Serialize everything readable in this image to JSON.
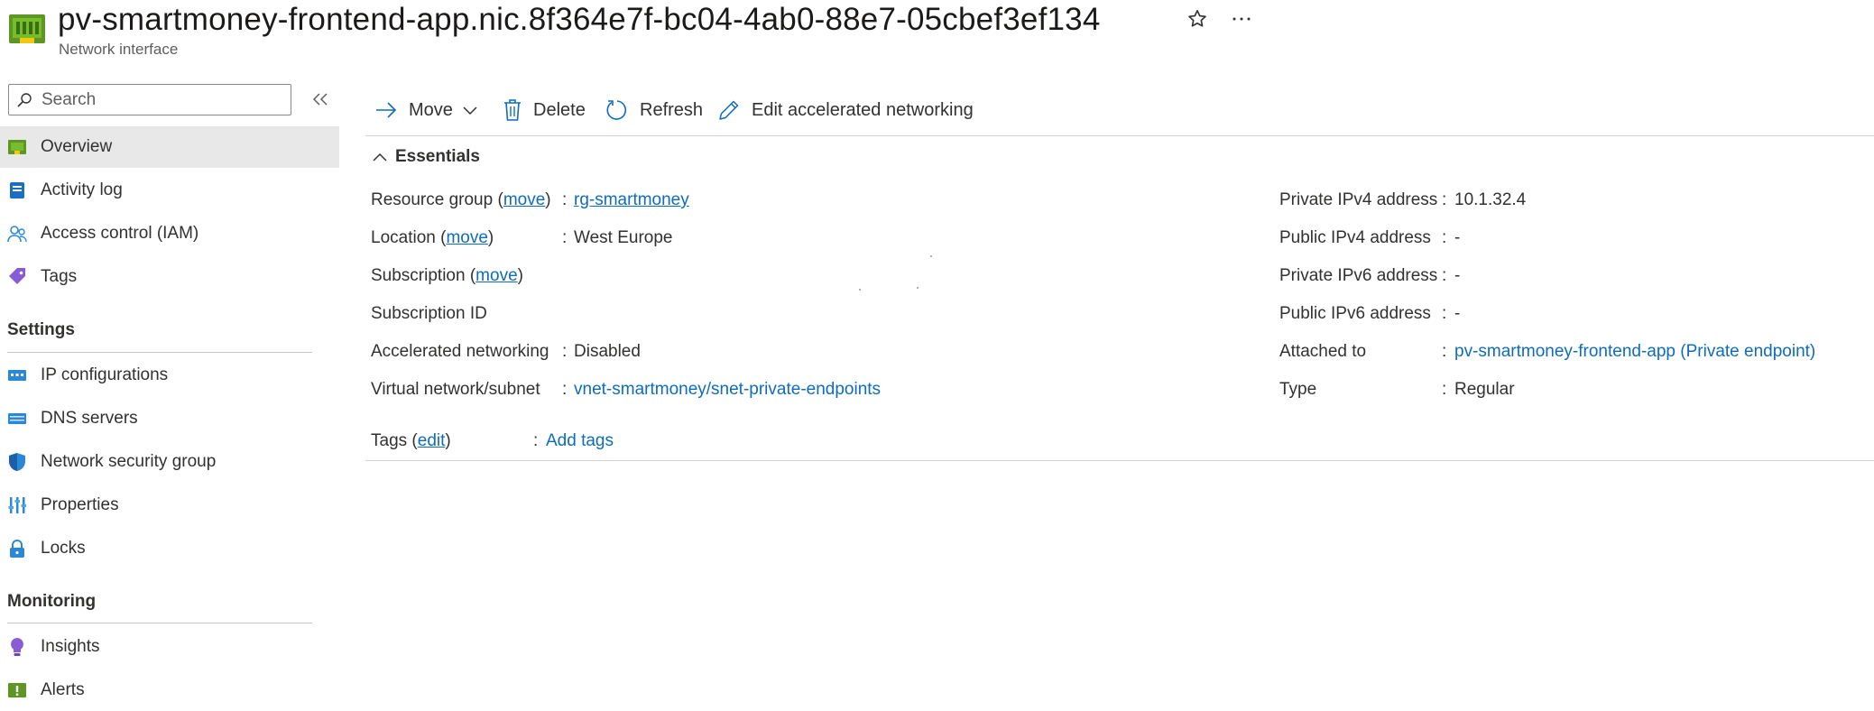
{
  "header": {
    "title": "pv-smartmoney-frontend-app.nic.8f364e7f-bc04-4ab0-88e7-05cbef3ef134",
    "subtitle": "Network interface",
    "icons": [
      "network-interface-icon",
      "star-icon",
      "more-icon"
    ]
  },
  "sidebar": {
    "search_placeholder": "Search",
    "items_top": [
      {
        "label": "Overview",
        "icon": "overview-icon",
        "active": true
      },
      {
        "label": "Activity log",
        "icon": "activity-log-icon"
      },
      {
        "label": "Access control (IAM)",
        "icon": "iam-icon"
      },
      {
        "label": "Tags",
        "icon": "tag-icon"
      }
    ],
    "settings_header": "Settings",
    "settings_items": [
      {
        "label": "IP configurations",
        "icon": "ip-config-icon"
      },
      {
        "label": "DNS servers",
        "icon": "dns-icon"
      },
      {
        "label": "Network security group",
        "icon": "shield-icon"
      },
      {
        "label": "Properties",
        "icon": "properties-icon"
      },
      {
        "label": "Locks",
        "icon": "lock-icon"
      }
    ],
    "monitoring_header": "Monitoring",
    "monitoring_items": [
      {
        "label": "Insights",
        "icon": "insights-icon"
      },
      {
        "label": "Alerts",
        "icon": "alert-icon"
      }
    ]
  },
  "toolbar": {
    "move": "Move",
    "delete": "Delete",
    "refresh": "Refresh",
    "edit_accel": "Edit accelerated networking"
  },
  "essentials": {
    "toggle_label": "Essentials",
    "left": {
      "resource_group": {
        "label": "Resource group",
        "action": "move",
        "value": "rg-smartmoney"
      },
      "location": {
        "label": "Location",
        "action": "move",
        "value": "West Europe"
      },
      "subscription": {
        "label": "Subscription",
        "action": "move",
        "value": ""
      },
      "subscription_id": {
        "label": "Subscription ID",
        "value": ""
      },
      "accelerated_networking": {
        "label": "Accelerated networking",
        "value": "Disabled"
      },
      "vnet_subnet": {
        "label": "Virtual network/subnet",
        "value": "vnet-smartmoney/snet-private-endpoints"
      }
    },
    "right": {
      "private_ipv4": {
        "label": "Private IPv4 address",
        "value": "10.1.32.4"
      },
      "public_ipv4": {
        "label": "Public IPv4 address",
        "value": "-"
      },
      "private_ipv6": {
        "label": "Private IPv6 address",
        "value": "-"
      },
      "public_ipv6": {
        "label": "Public IPv6 address",
        "value": "-"
      },
      "attached_to": {
        "label": "Attached to",
        "value": "pv-smartmoney-frontend-app (Private endpoint)"
      },
      "type": {
        "label": "Type",
        "value": "Regular"
      }
    },
    "tags": {
      "label": "Tags",
      "action": "edit",
      "value": "Add tags"
    }
  },
  "colors": {
    "accent": "#0f6cbd",
    "active_bg": "#e8e8e8",
    "text": "#323130"
  }
}
